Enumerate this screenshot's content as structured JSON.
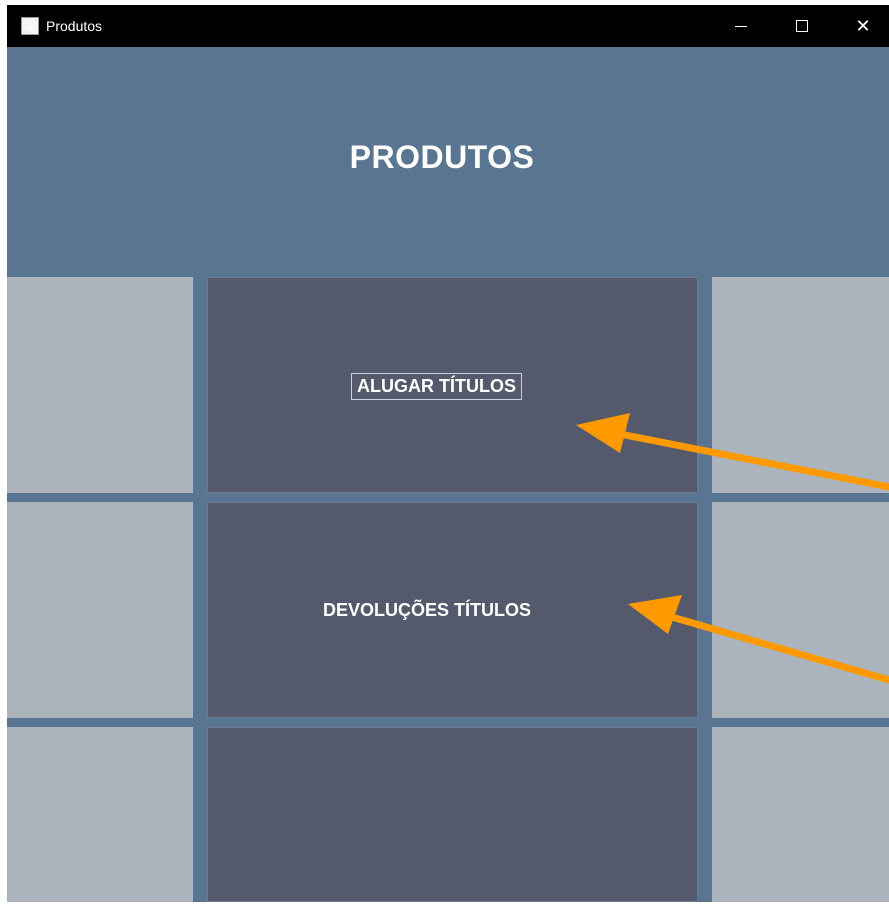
{
  "window": {
    "title": "Produtos",
    "icon": "java-cup-icon",
    "controls": [
      "minimize",
      "maximize",
      "close"
    ]
  },
  "header": {
    "title": "PRODUTOS"
  },
  "menu": {
    "items": [
      {
        "label": "ALUGAR TÍTULOS"
      },
      {
        "label": "DEVOLUÇÕES TÍTULOS"
      },
      {
        "label": ""
      }
    ]
  },
  "colors": {
    "background": "#5a7591",
    "center_tile": "#545a6c",
    "side_tile": "#abb4bd",
    "annotation_arrow": "#ff9900"
  }
}
